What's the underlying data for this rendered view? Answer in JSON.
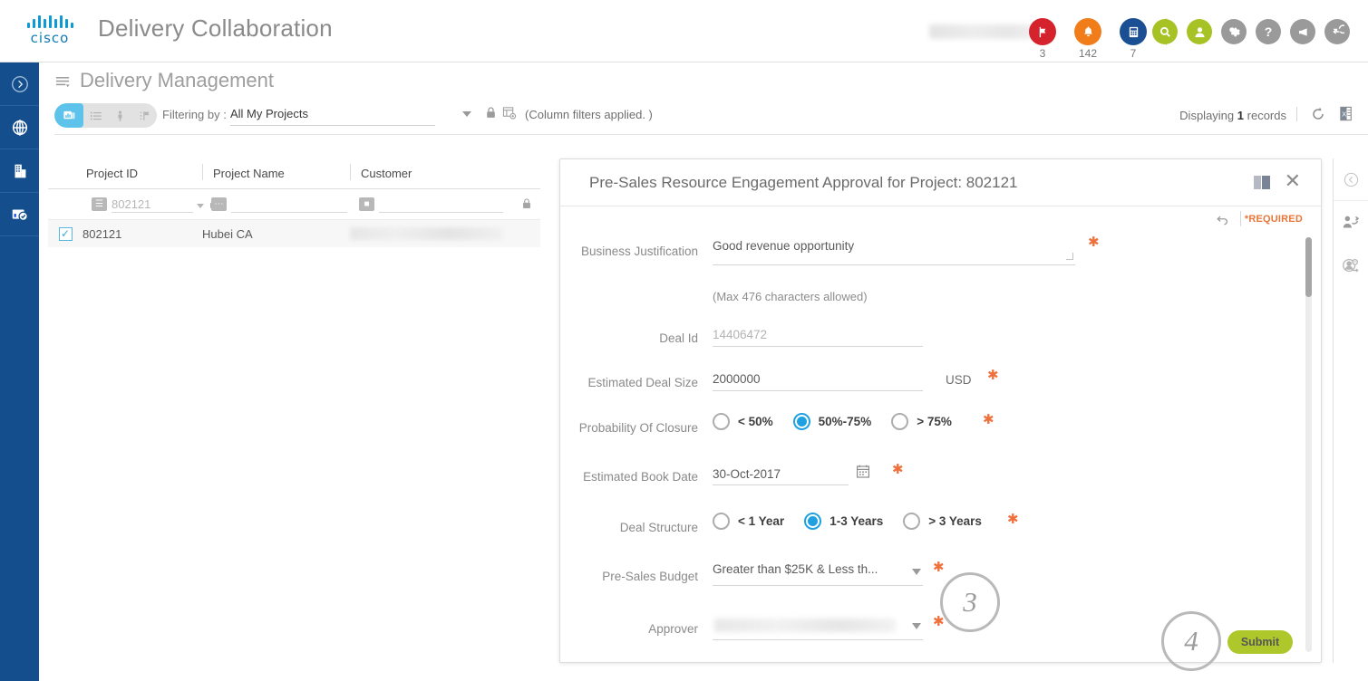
{
  "header": {
    "brand": "cisco",
    "app_title": "Delivery Collaboration",
    "username_redacted": "",
    "badges": [
      {
        "icon": "flag-badge-icon",
        "count": "3",
        "color": "#d5232e"
      },
      {
        "icon": "bell-badge-icon",
        "count": "142",
        "color": "#f07d1a"
      },
      {
        "icon": "calculator-badge-icon",
        "count": "7",
        "color": "#1a4f93"
      }
    ],
    "actions": [
      {
        "icon": "search-icon",
        "color": "#a7c224",
        "glyph": "⌕"
      },
      {
        "icon": "user-icon",
        "color": "#a7c224",
        "glyph": "●"
      },
      {
        "icon": "gear-icon",
        "color": "#9a9a9a",
        "glyph": "⚙"
      },
      {
        "icon": "help-icon",
        "color": "#9a9a9a",
        "glyph": "?"
      },
      {
        "icon": "feedback-megaphone-icon",
        "color": "#9a9a9a",
        "glyph": "◀"
      },
      {
        "icon": "logout-icon",
        "color": "#9a9a9a",
        "glyph": "↩"
      }
    ]
  },
  "left_rail": {
    "items": [
      {
        "name": "expand-rail-icon",
        "glyph": "›"
      },
      {
        "name": "globe-icon",
        "glyph": "⊕"
      },
      {
        "name": "building-icon",
        "glyph": "Ἶ2"
      },
      {
        "name": "dashboard-check-icon",
        "glyph": "☑"
      }
    ]
  },
  "page": {
    "title": "Delivery Management",
    "view_modes": [
      {
        "name": "chart-view",
        "active": true
      },
      {
        "name": "list-view",
        "active": false
      },
      {
        "name": "person-view",
        "active": false
      },
      {
        "name": "flag-view",
        "active": false
      }
    ],
    "filtering_label": "Filtering by :",
    "filter_value": "All My Projects",
    "column_filters_note": "(Column filters applied. )",
    "displaying_prefix": "Displaying",
    "displaying_count": "1",
    "displaying_suffix": "records"
  },
  "grid": {
    "columns": [
      "Project ID",
      "Project Name",
      "Customer"
    ],
    "filter_row": {
      "project_id_value": "802121",
      "project_name_value": "",
      "customer_value": ""
    },
    "rows": [
      {
        "checked": true,
        "project_id": "802121",
        "project_name": "Hubei CA",
        "customer_redacted": ""
      }
    ]
  },
  "modal": {
    "title": "Pre-Sales Resource Engagement Approval for Project: 802121",
    "required_note": "*REQUIRED",
    "fields": {
      "business_justification": {
        "label": "Business Justification",
        "value": "Good revenue opportunity",
        "hint": "(Max 476 characters allowed)",
        "required": true
      },
      "deal_id": {
        "label": "Deal Id",
        "value": "14406472",
        "required": false
      },
      "estimated_deal_size": {
        "label": "Estimated Deal Size",
        "value": "2000000",
        "currency": "USD",
        "required": true
      },
      "probability_of_closure": {
        "label": "Probability Of Closure",
        "options": [
          "< 50%",
          "50%-75%",
          "> 75%"
        ],
        "selected": "50%-75%",
        "required": true
      },
      "estimated_book_date": {
        "label": "Estimated Book Date",
        "value": "30-Oct-2017",
        "required": true
      },
      "deal_structure": {
        "label": "Deal Structure",
        "options": [
          "< 1 Year",
          "1-3 Years",
          "> 3 Years"
        ],
        "selected": "1-3 Years",
        "required": true
      },
      "pre_sales_budget": {
        "label": "Pre-Sales Budget",
        "value": "Greater than $25K & Less th...",
        "required": true
      },
      "approver": {
        "label": "Approver",
        "value": "",
        "required": true
      }
    },
    "submit_label": "Submit"
  },
  "annotations": [
    {
      "name": "annotation-step-3",
      "number": "3"
    },
    {
      "name": "annotation-step-4",
      "number": "4"
    }
  ],
  "right_rail": {
    "items": [
      {
        "name": "collapse-rail-icon"
      },
      {
        "name": "transfer-user-icon"
      },
      {
        "name": "assign-user-icon"
      }
    ]
  },
  "colors": {
    "cisco_blue": "#0d7cb5",
    "rail_blue": "#144e8c",
    "accent_blue": "#1fa0e0",
    "required_orange": "#e8763a",
    "submit_green": "#aec82b"
  }
}
